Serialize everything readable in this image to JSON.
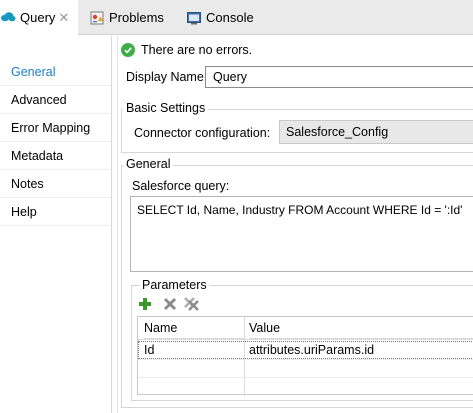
{
  "tabs": [
    {
      "label": "Query",
      "icon": "salesforce-cloud-icon",
      "active": true
    },
    {
      "label": "Problems",
      "icon": "problems-icon"
    },
    {
      "label": "Console",
      "icon": "console-icon"
    }
  ],
  "nav": {
    "items": [
      "General",
      "Advanced",
      "Error Mapping",
      "Metadata",
      "Notes",
      "Help"
    ],
    "active": "General"
  },
  "status": {
    "message": "There are no errors.",
    "icon": "check-circle-icon"
  },
  "display_name": {
    "label": "Display Name:",
    "value": "Query"
  },
  "basic_settings": {
    "title": "Basic Settings",
    "connector_label": "Connector configuration:",
    "connector_value": "Salesforce_Config"
  },
  "general": {
    "title": "General",
    "query_label": "Salesforce query:",
    "query_value": "SELECT Id, Name, Industry FROM Account WHERE Id = ':Id'"
  },
  "parameters": {
    "title": "Parameters",
    "toolbar": [
      "add-icon",
      "remove-icon",
      "remove-all-icon"
    ],
    "columns": [
      "Name",
      "Value"
    ],
    "rows": [
      {
        "name": "Id",
        "value": "attributes.uriParams.id"
      }
    ]
  },
  "colors": {
    "accent": "#1c7ec5",
    "ok": "#3fae49",
    "add": "#3c9a2c"
  }
}
